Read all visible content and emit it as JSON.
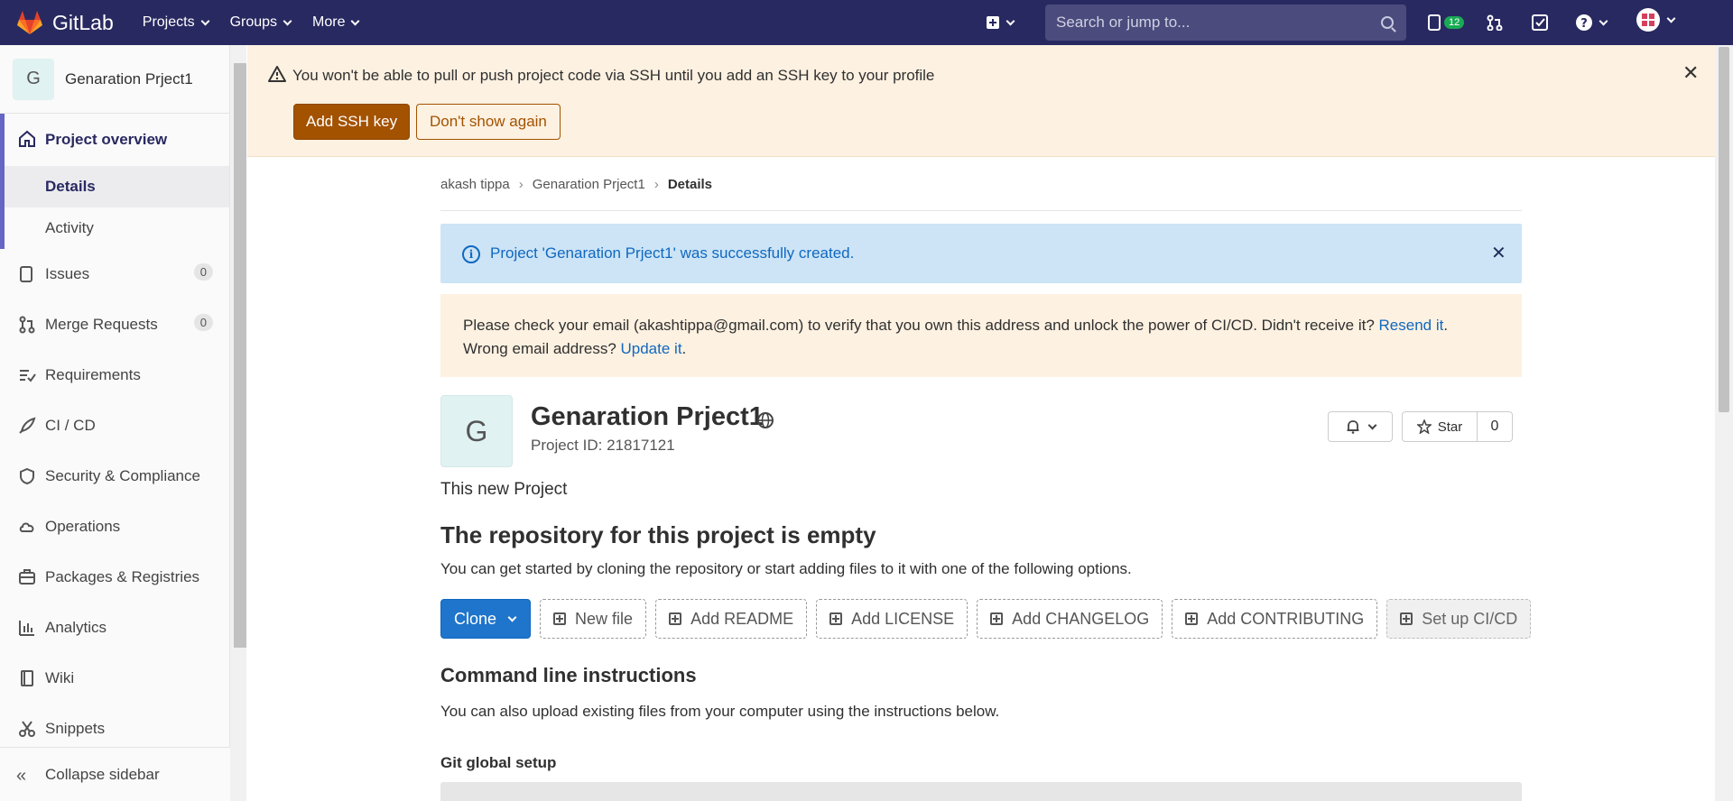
{
  "topnav": {
    "brand": "GitLab",
    "menus": [
      "Projects",
      "Groups",
      "More"
    ],
    "search_placeholder": "Search or jump to...",
    "issues_badge": "12"
  },
  "sidebar": {
    "project_initial": "G",
    "project_name": "Genaration Prject1",
    "overview": "Project overview",
    "details": "Details",
    "activity": "Activity",
    "issues": "Issues",
    "issues_count": "0",
    "merge_requests": "Merge Requests",
    "mr_count": "0",
    "requirements": "Requirements",
    "cicd": "CI / CD",
    "security": "Security & Compliance",
    "operations": "Operations",
    "packages": "Packages & Registries",
    "analytics": "Analytics",
    "wiki": "Wiki",
    "snippets": "Snippets",
    "collapse": "Collapse sidebar"
  },
  "ssh_alert": {
    "text": "You won't be able to pull or push project code via SSH until you add an SSH key to your profile",
    "add_button": "Add SSH key",
    "dismiss_button": "Don't show again"
  },
  "breadcrumb": {
    "user": "akash tippa",
    "project": "Genaration Prject1",
    "current": "Details"
  },
  "info_alert": {
    "text": "Project 'Genaration Prject1' was successfully created."
  },
  "email_alert": {
    "text1": "Please check your email (akashtippa@gmail.com) to verify that you own this address and unlock the power of CI/CD. Didn't receive it? ",
    "resend": "Resend it",
    "text2": "Wrong email address? ",
    "update": "Update it"
  },
  "project": {
    "initial": "G",
    "title": "Genaration Prject1",
    "id_text": "Project ID: 21817121",
    "star_label": "Star",
    "star_count": "0",
    "description": "This new Project"
  },
  "empty_repo": {
    "heading": "The repository for this project is empty",
    "subtext": "You can get started by cloning the repository or start adding files to it with one of the following options.",
    "clone": "Clone",
    "buttons": [
      "New file",
      "Add README",
      "Add LICENSE",
      "Add CHANGELOG",
      "Add CONTRIBUTING",
      "Set up CI/CD"
    ]
  },
  "cli": {
    "heading": "Command line instructions",
    "subtext": "You can also upload existing files from your computer using the instructions below.",
    "git_global": "Git global setup"
  },
  "colors": {
    "nav_bg": "#292961",
    "warning_btn": "#a35200",
    "info_bg": "#cce4f6",
    "primary_btn": "#1f75cb"
  }
}
